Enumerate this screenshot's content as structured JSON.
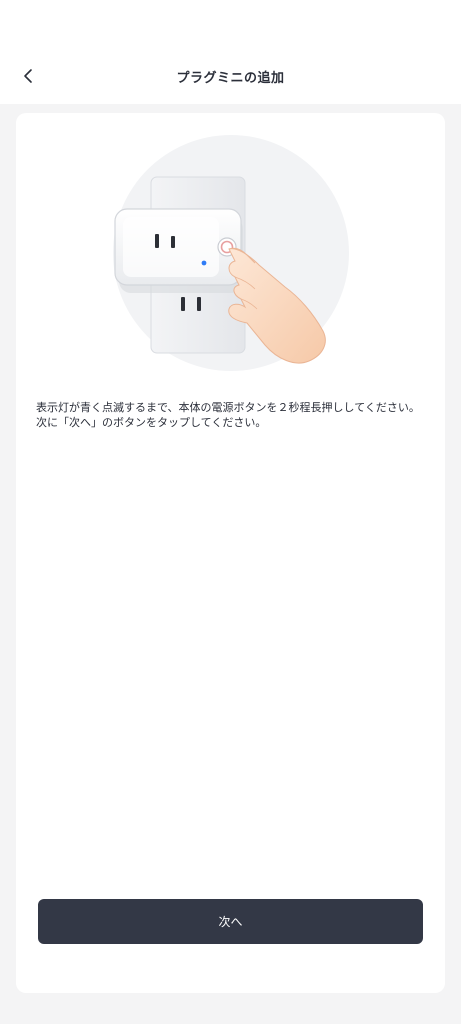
{
  "header": {
    "title": "プラグミニの追加",
    "back_icon": "chevron-left-icon"
  },
  "main": {
    "instruction": "表示灯が青く点滅するまで、本体の電源ボタンを２秒程長押ししてください。次に「次へ」のボタンをタップしてください。",
    "illustration": "smart-plug-press-button-illustration"
  },
  "footer": {
    "next_label": "次へ"
  },
  "colors": {
    "background": "#f4f4f5",
    "card": "#ffffff",
    "button": "#333846",
    "indicator_led": "#2f7cf6",
    "power_ring": "#e8a0a0"
  }
}
